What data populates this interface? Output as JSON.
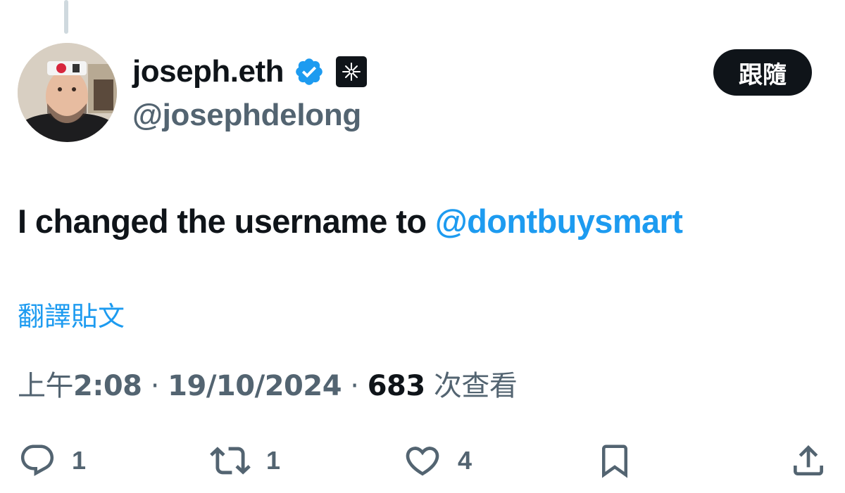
{
  "tweet": {
    "display_name": "joseph.eth",
    "handle": "@josephdelong",
    "text_prefix": "I changed the username to ",
    "mention": "@dontbuysmart",
    "translate_label": "翻譯貼文",
    "time_prefix": "上午",
    "time": "2:08",
    "separator": " · ",
    "date": "19/10/2024",
    "views_count": "683",
    "views_label": " 次查看"
  },
  "follow_button": {
    "label": "跟隨"
  },
  "actions": {
    "reply_count": "1",
    "repost_count": "1",
    "like_count": "4"
  },
  "icons": {
    "verified": "verified-badge-icon",
    "affiliate": "affiliate-badge-icon",
    "reply": "reply-icon",
    "repost": "repost-icon",
    "like": "heart-icon",
    "bookmark": "bookmark-icon",
    "share": "share-icon"
  },
  "colors": {
    "text_primary": "#0f1419",
    "text_secondary": "#536471",
    "accent": "#1d9bf0",
    "button_bg": "#0f1419",
    "thread_line": "#cfd9de"
  }
}
